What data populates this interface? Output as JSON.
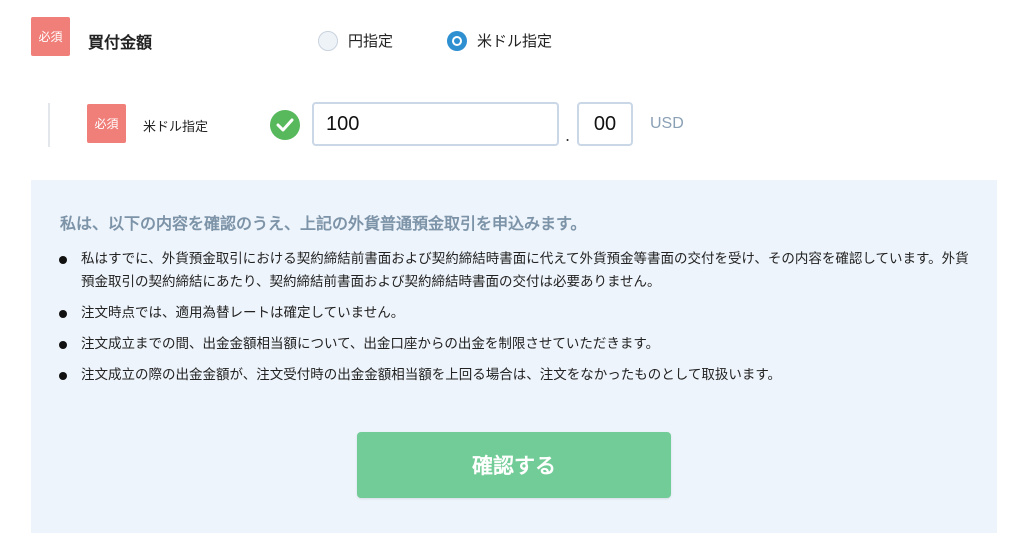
{
  "form": {
    "required_badge": "必須",
    "purchase_amount_label": "買付金額",
    "currency_options": [
      {
        "label": "円指定",
        "selected": false
      },
      {
        "label": "米ドル指定",
        "selected": true
      }
    ],
    "sub_label": "米ドル指定",
    "amount_integer": "100",
    "decimal_separator": ".",
    "amount_decimal": "00",
    "currency_code": "USD"
  },
  "agreement": {
    "title": "私は、以下の内容を確認のうえ、上記の外貨普通預金取引を申込みます。",
    "items": [
      "私はすでに、外貨預金取引における契約締結前書面および契約締結時書面に代えて外貨預金等書面の交付を受け、その内容を確認しています。外貨預金取引の契約締結にあたり、契約締結前書面および契約締結時書面の交付は必要ありません。",
      "注文時点では、適用為替レートは確定していません。",
      "注文成立までの間、出金金額相当額について、出金口座からの出金を制限させていただきます。",
      "注文成立の際の出金金額が、注文受付時の出金金額相当額を上回る場合は、注文をなかったものとして取扱います。"
    ],
    "confirm_button": "確認する"
  },
  "colors": {
    "required_badge": "#f07f7a",
    "radio_selected": "#2e8fd1",
    "check_ok": "#58b85c",
    "panel_bg": "#eef4fb",
    "confirm_button": "#72cc97"
  },
  "icons": {
    "validation": "check-circle-icon"
  }
}
